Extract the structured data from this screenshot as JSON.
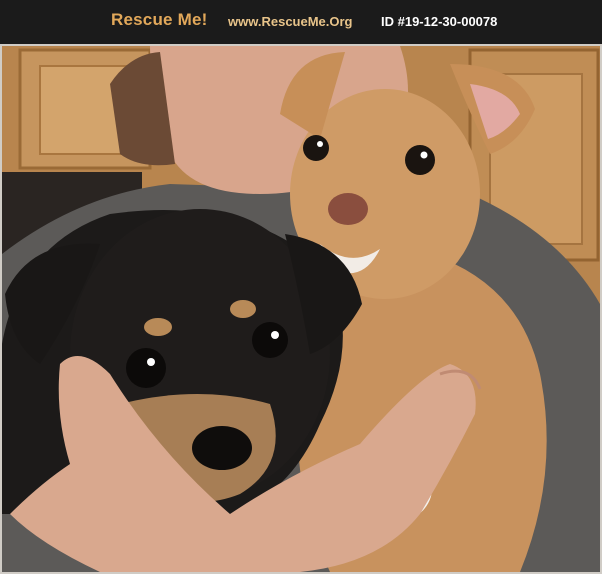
{
  "header": {
    "logo_text": "Rescue Me!",
    "site_url": "www.RescueMe.Org",
    "pet_id": "ID #19-12-30-00078"
  },
  "colors": {
    "header_bg": "#1b1b1b",
    "logo": "#e2a85a",
    "site_url": "#e8c48a",
    "pet_id": "#ffffff"
  },
  "photo": {
    "icon": "puppies-photo"
  }
}
